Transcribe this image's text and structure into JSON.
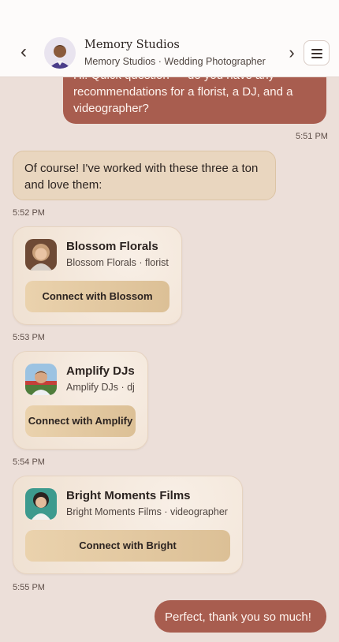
{
  "header": {
    "back_icon": "chevron-left-icon",
    "name": "Memory Studios",
    "subtitle": "Memory Studios · Wedding Photographer",
    "forward_icon": "chevron-right-icon",
    "menu_icon": "hamburger-menu-icon"
  },
  "messages": [
    {
      "from": "me",
      "text": "Hi! Quick question — do you have any recommendations for a florist, a DJ, and a videographer?",
      "time": "5:51 PM"
    },
    {
      "from": "vendor",
      "text": "Of course! I've worked with these three a ton and love them:",
      "time": "5:52 PM"
    },
    {
      "type": "vendor_card",
      "name": "Blossom Florals",
      "subtitle": "Blossom Florals · florist",
      "button": "Connect with Blossom",
      "time": "5:53 PM"
    },
    {
      "type": "vendor_card",
      "name": "Amplify DJs",
      "subtitle": "Amplify DJs · dj",
      "button": "Connect with Amplify",
      "time": "5:54 PM"
    },
    {
      "type": "vendor_card",
      "name": "Bright Moments Films",
      "subtitle": "Bright Moments Films · videographer",
      "button": "Connect with Bright",
      "time": "5:55 PM"
    },
    {
      "from": "me",
      "text": "Perfect, thank you so much!"
    }
  ],
  "colors": {
    "background": "#ecdfd9",
    "outgoing_bubble": "#a85d4f",
    "incoming_bubble": "#e9d6bf",
    "connect_button": "#dcc096"
  }
}
